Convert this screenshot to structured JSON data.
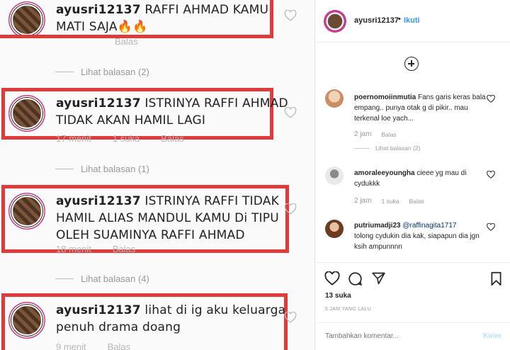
{
  "left_comments": [
    {
      "user": "ayusri12137",
      "text": "RAFFI AHMAD KAMU",
      "text2": "MATI SAJA🔥🔥",
      "meta": "Balas",
      "replies": "Lihat balasan (2)"
    },
    {
      "user": "ayusri12137",
      "text": "ISTRINYA RAFFI AHMAD",
      "text2": "TIDAK AKAN HAMIL LAGI",
      "meta_time": "17 menit",
      "meta_likes": "1 suka",
      "meta_reply": "Balas",
      "replies": "Lihat balasan (1)"
    },
    {
      "user": "ayusri12137",
      "text": "ISTRINYA RAFFI TIDAK",
      "text2": "HAMIL ALIAS MANDUL KAMU Di TIPU",
      "text3": "OLEH SUAMINYA RAFFI AHMAD",
      "meta_time": "18 menit",
      "meta_reply": "Balas",
      "replies": "Lihat balasan (4)"
    },
    {
      "user": "ayusri12137",
      "text": "lihat di ig aku keluarga",
      "text2": "penuh drama doang",
      "meta_time": "9 menit",
      "meta_reply": "Balas"
    }
  ],
  "header": {
    "username": "ayusri12137",
    "dot": "•",
    "follow": "Ikuti",
    "more": "•••"
  },
  "comments": [
    {
      "user": "poernomoiinmutia",
      "text": "Fans garis keras bala empang.. punya otak g di pikir.. mau terkenal loe yach...",
      "time": "2 jam",
      "reply": "Balas",
      "view_replies": "Lihat balasan (2)",
      "avatar_color": "#d9b89a"
    },
    {
      "user": "amoraleeyoungha",
      "text": "cieee yg mau di cydukkk",
      "time": "2 jam",
      "likes": "1 suka",
      "reply": "Balas",
      "avatar_color": "#5a5a5a"
    },
    {
      "user": "putriumadji23",
      "mention": "@raffinagita1717",
      "text": "tolong cydukin dia kak, siapapun dia jgn ksih ampunnnn",
      "avatar_color": "#b0764a"
    }
  ],
  "post": {
    "likes": "13 suka",
    "time": "6 JAM YANG LALU"
  },
  "add_comment": {
    "placeholder": "Tambahkan komentar...",
    "post_label": "Kirim"
  },
  "colors": {
    "highlight": "#e03b3b",
    "link": "#3897f0",
    "text": "#262626",
    "muted": "#999999"
  }
}
